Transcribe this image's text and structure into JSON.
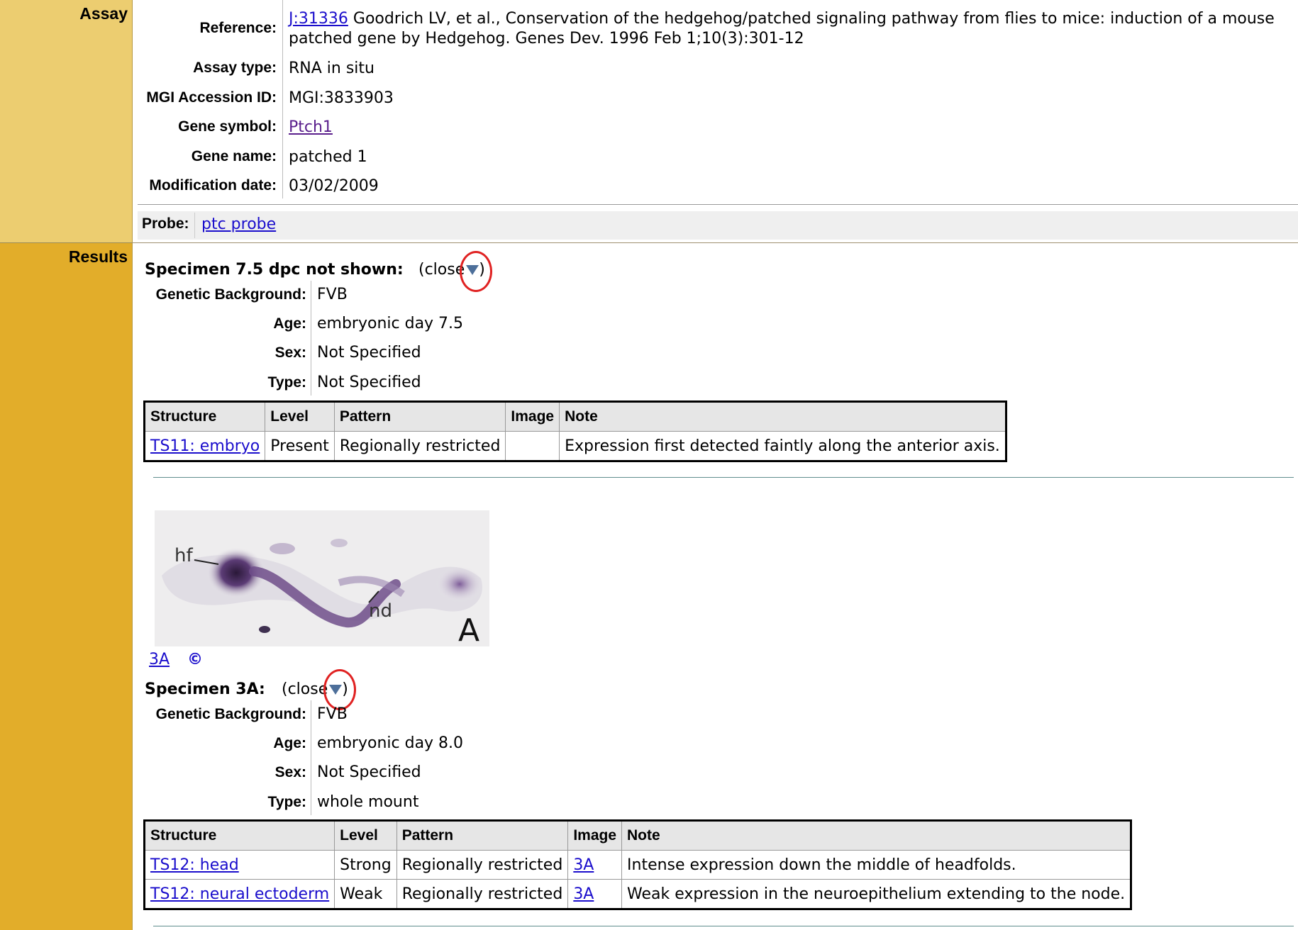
{
  "assay": {
    "section_label": "Assay",
    "reference_label": "Reference:",
    "reference_link": "J:31336",
    "reference_line1": "Goodrich LV, et al., Conservation of the hedgehog/patched signaling pathway from flies to mice: induction of a mouse",
    "reference_line2": "patched gene by Hedgehog. Genes Dev. 1996 Feb 1;10(3):301-12",
    "assay_type_label": "Assay type:",
    "assay_type": "RNA in situ",
    "accession_label": "MGI Accession ID:",
    "accession": "MGI:3833903",
    "gene_symbol_label": "Gene symbol:",
    "gene_symbol": "Ptch1",
    "gene_name_label": "Gene name:",
    "gene_name": "patched 1",
    "mod_date_label": "Modification date:",
    "mod_date": "03/02/2009",
    "probe_label": "Probe:",
    "probe": "ptc probe"
  },
  "results": {
    "section_label": "Results",
    "attr_labels": {
      "genetic_background": "Genetic Background:",
      "age": "Age:",
      "sex": "Sex:",
      "type": "Type:"
    },
    "table_headers": {
      "structure": "Structure",
      "level": "Level",
      "pattern": "Pattern",
      "image": "Image",
      "note": "Note"
    },
    "specimens": [
      {
        "title": "Specimen 7.5 dpc not shown:",
        "close_text": "(close",
        "close_end": ")",
        "genetic_background": "FVB",
        "age": "embryonic day 7.5",
        "sex": "Not Specified",
        "type": "Not Specified",
        "rows": [
          {
            "structure": "TS11: embryo",
            "level": "Present",
            "pattern": "Regionally restricted",
            "image": "",
            "note": "Expression first detected faintly along the anterior axis."
          }
        ]
      },
      {
        "title": "Specimen 3A:",
        "close_text": "(close",
        "close_end": ")",
        "genetic_background": "FVB",
        "age": "embryonic day 8.0",
        "sex": "Not Specified",
        "type": "whole mount",
        "rows": [
          {
            "structure": "TS12: head",
            "level": "Strong",
            "pattern": "Regionally restricted",
            "image": "3A",
            "note": "Intense expression down the middle of headfolds."
          },
          {
            "structure": "TS12: neural ectoderm",
            "level": "Weak",
            "pattern": "Regionally restricted",
            "image": "3A",
            "note": "Weak expression in the neuroepithelium extending to the node."
          }
        ]
      }
    ],
    "figure": {
      "label_hf": "hf",
      "label_nd": "nd",
      "label_panel": "A",
      "link": "3A",
      "copyright_symbol": "©"
    }
  }
}
